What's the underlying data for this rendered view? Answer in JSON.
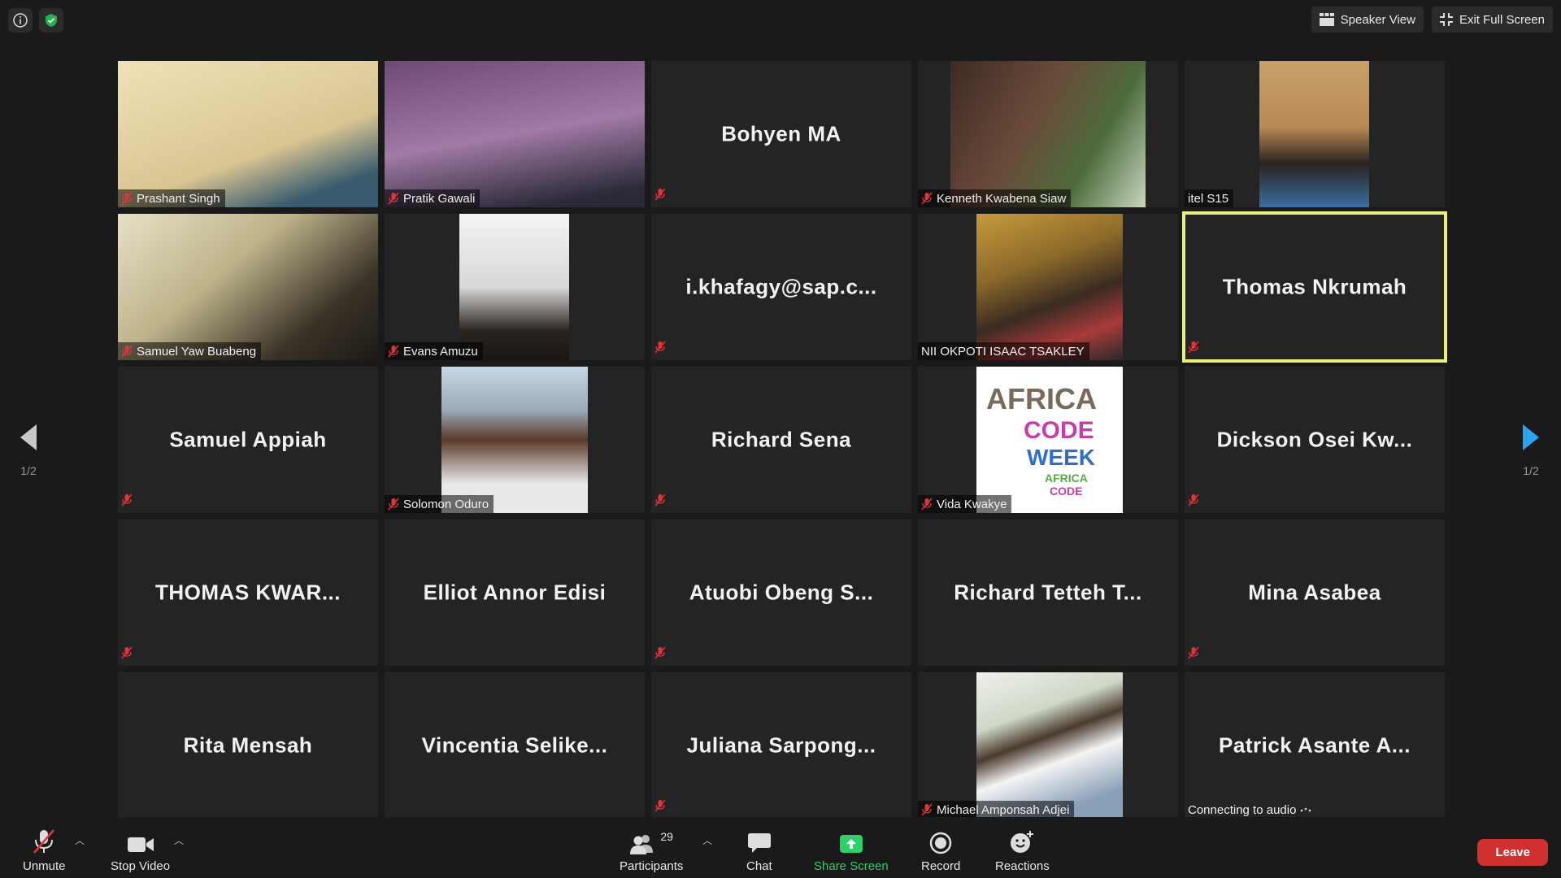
{
  "top_bar": {
    "speaker_view": "Speaker View",
    "exit_full_screen": "Exit Full Screen"
  },
  "pager": {
    "left": "1/2",
    "right": "1/2"
  },
  "tiles": [
    {
      "name": "Prashant Singh",
      "center": "",
      "status": ""
    },
    {
      "name": "Pratik Gawali",
      "center": "",
      "status": ""
    },
    {
      "name": "",
      "center": "Bohyen MA",
      "status": ""
    },
    {
      "name": "Kenneth Kwabena Siaw",
      "center": "",
      "status": ""
    },
    {
      "name": "itel S15",
      "center": "",
      "status": ""
    },
    {
      "name": "Samuel Yaw Buabeng",
      "center": "",
      "status": ""
    },
    {
      "name": "Evans Amuzu",
      "center": "",
      "status": ""
    },
    {
      "name": "",
      "center": "i.khafagy@sap.c...",
      "status": ""
    },
    {
      "name": "NII OKPOTI ISAAC TSAKLEY",
      "center": "",
      "status": ""
    },
    {
      "name": "",
      "center": "Thomas Nkrumah",
      "status": ""
    },
    {
      "name": "",
      "center": "Samuel Appiah",
      "status": ""
    },
    {
      "name": "Solomon Oduro",
      "center": "",
      "status": ""
    },
    {
      "name": "",
      "center": "Richard Sena",
      "status": ""
    },
    {
      "name": "Vida Kwakye",
      "center": "",
      "status": "",
      "art": {
        "africa": "AFRICA",
        "code": "CODE",
        "week": "WEEK",
        "africa2": "AFRICA",
        "code2": "CODE"
      }
    },
    {
      "name": "",
      "center": "Dickson Osei Kw...",
      "status": ""
    },
    {
      "name": "",
      "center": "THOMAS KWAR...",
      "status": ""
    },
    {
      "name": "",
      "center": "Elliot Annor Edisi",
      "status": ""
    },
    {
      "name": "",
      "center": "Atuobi Obeng S...",
      "status": ""
    },
    {
      "name": "",
      "center": "Richard Tetteh T...",
      "status": ""
    },
    {
      "name": "",
      "center": "Mina Asabea",
      "status": ""
    },
    {
      "name": "",
      "center": "Rita Mensah",
      "status": ""
    },
    {
      "name": "",
      "center": "Vincentia Selike...",
      "status": ""
    },
    {
      "name": "",
      "center": "Juliana Sarpong...",
      "status": ""
    },
    {
      "name": "Michael Amponsah Adjei",
      "center": "",
      "status": ""
    },
    {
      "name": "",
      "center": "Patrick Asante A...",
      "status": "Connecting to audio"
    }
  ],
  "toolbar": {
    "unmute": "Unmute",
    "stop_video": "Stop Video",
    "participants": "Participants",
    "participant_count": "29",
    "chat": "Chat",
    "share_screen": "Share Screen",
    "record": "Record",
    "reactions": "Reactions",
    "leave": "Leave"
  },
  "colors": {
    "active_speaker": "#e6f07a",
    "muted": "#e0343a",
    "share": "#2fd06a",
    "leave": "#d0302f"
  }
}
